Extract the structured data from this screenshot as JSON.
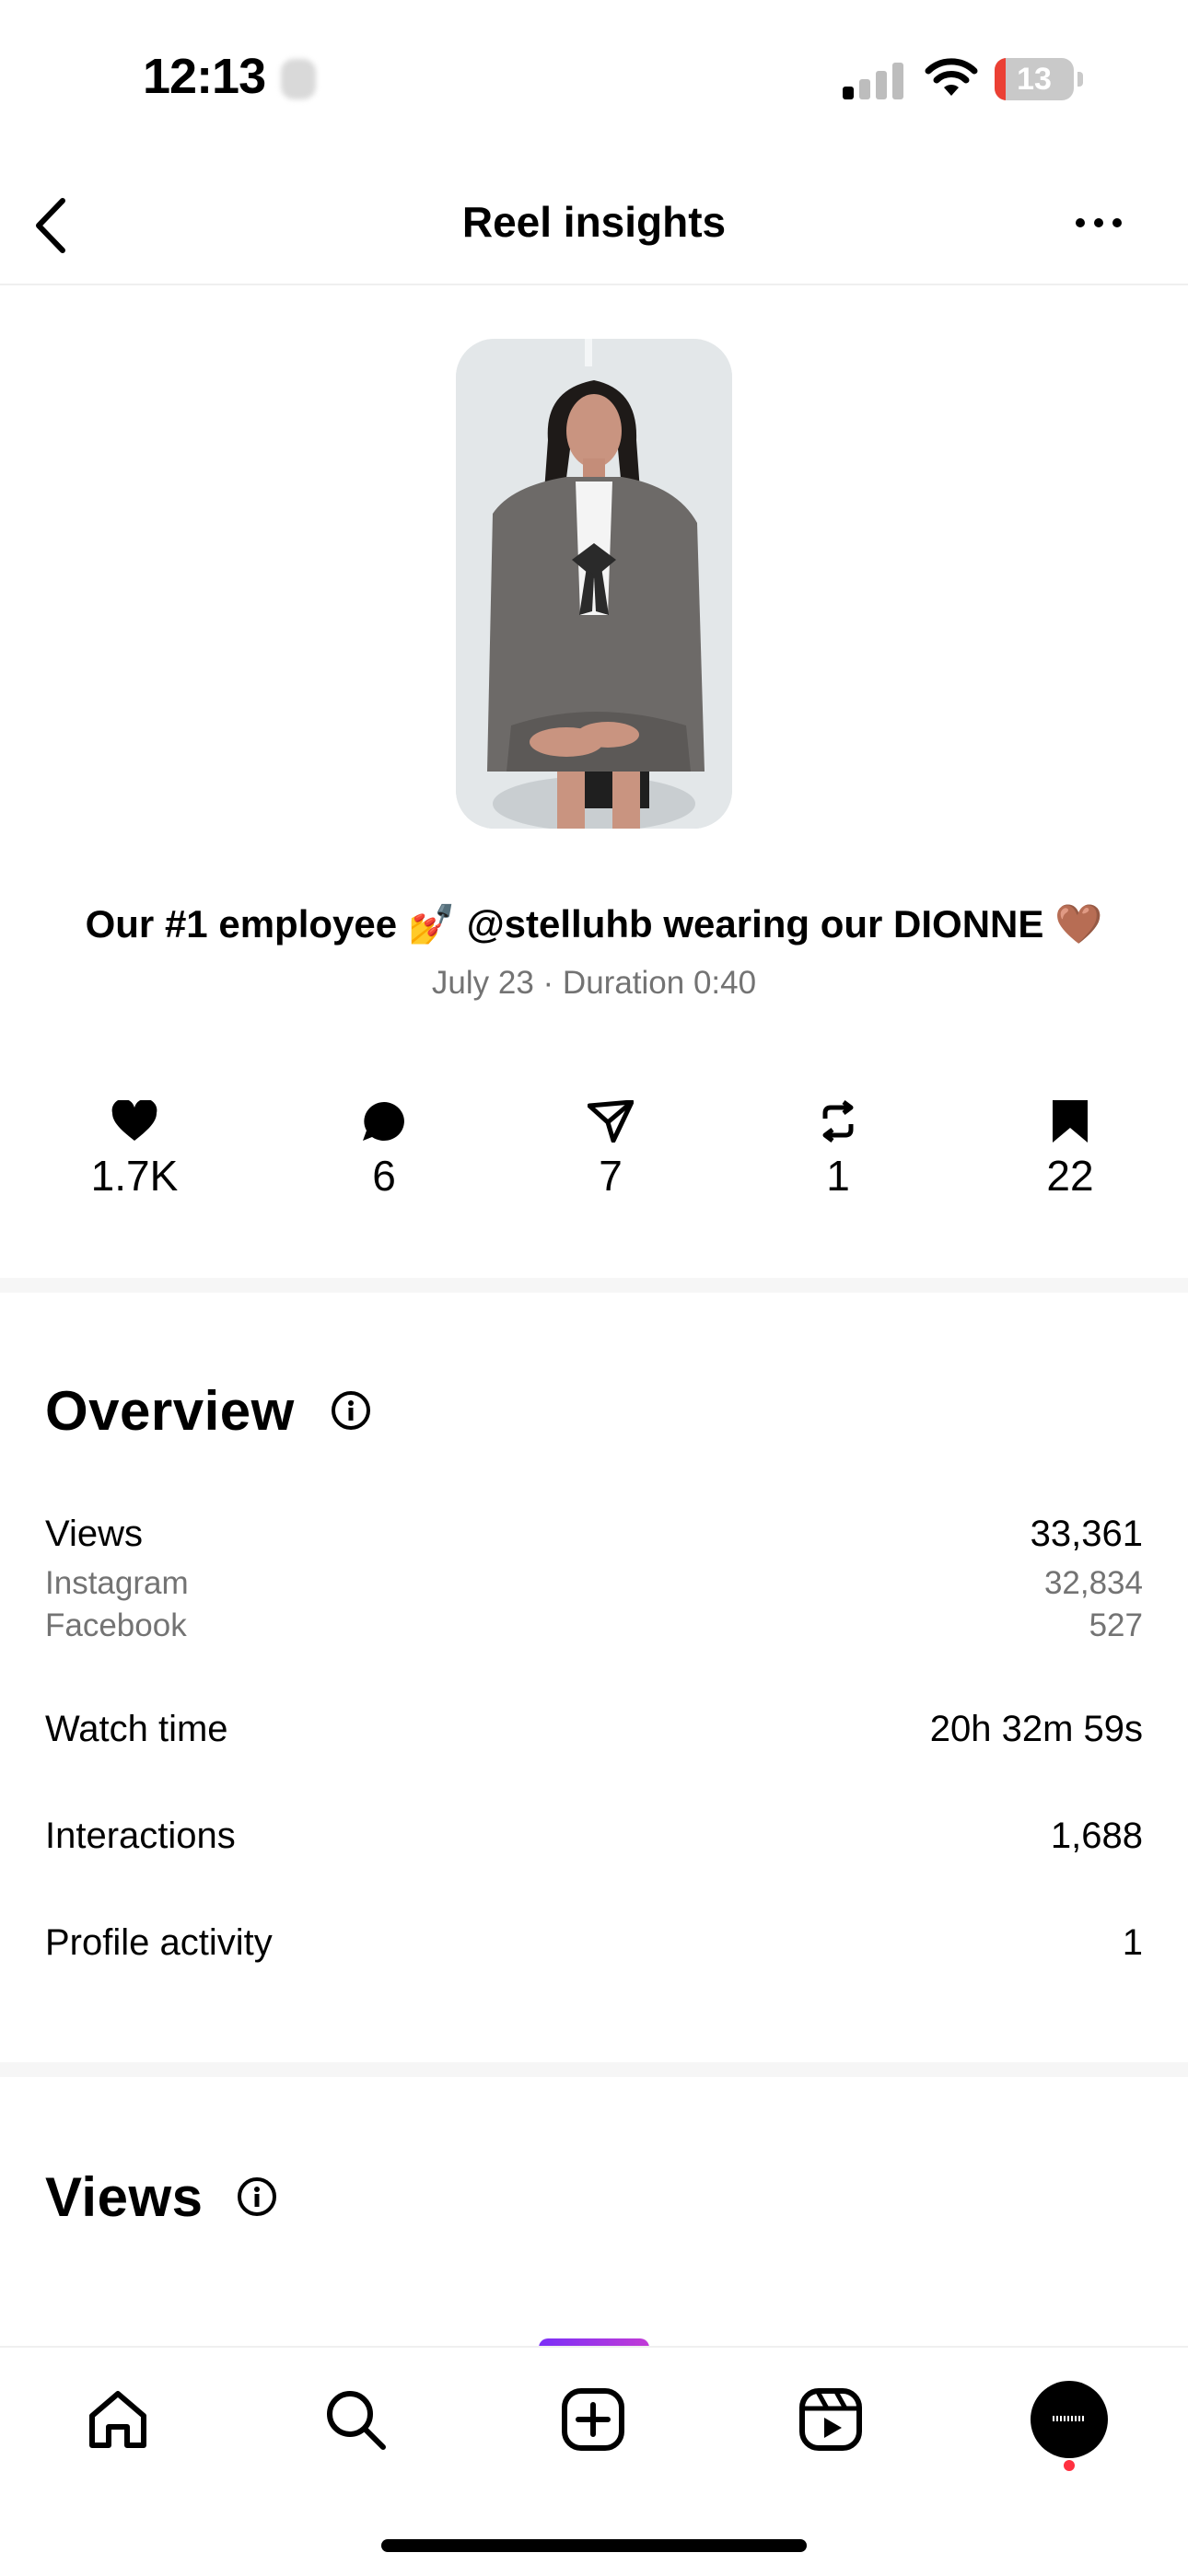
{
  "status_bar": {
    "time": "12:13",
    "battery_level": "13"
  },
  "nav": {
    "title": "Reel insights",
    "back_icon": "chevron-left-icon",
    "more_icon": "ellipsis-icon"
  },
  "reel": {
    "caption": "Our #1 employee 💅 @stelluhb wearing our DIONNE 🤎",
    "meta": "July 23 · Duration 0:40"
  },
  "stats": [
    {
      "icon": "heart-icon",
      "value": "1.7K"
    },
    {
      "icon": "comment-icon",
      "value": "6"
    },
    {
      "icon": "send-icon",
      "value": "7"
    },
    {
      "icon": "repost-icon",
      "value": "1"
    },
    {
      "icon": "bookmark-icon",
      "value": "22"
    }
  ],
  "overview": {
    "title": "Overview",
    "views": {
      "label": "Views",
      "value": "33,361"
    },
    "instagram": {
      "label": "Instagram",
      "value": "32,834"
    },
    "facebook": {
      "label": "Facebook",
      "value": "527"
    },
    "watch_time": {
      "label": "Watch time",
      "value": "20h 32m 59s"
    },
    "interactions": {
      "label": "Interactions",
      "value": "1,688"
    },
    "profile_activity": {
      "label": "Profile activity",
      "value": "1"
    }
  },
  "views_section": {
    "title": "Views"
  },
  "tabbar": [
    "home-icon",
    "search-icon",
    "create-icon",
    "reels-icon",
    "profile-avatar"
  ],
  "colors": {
    "secondary_text": "#737373",
    "battery_low": "#eb4034",
    "notification_dot": "#ff3040"
  }
}
